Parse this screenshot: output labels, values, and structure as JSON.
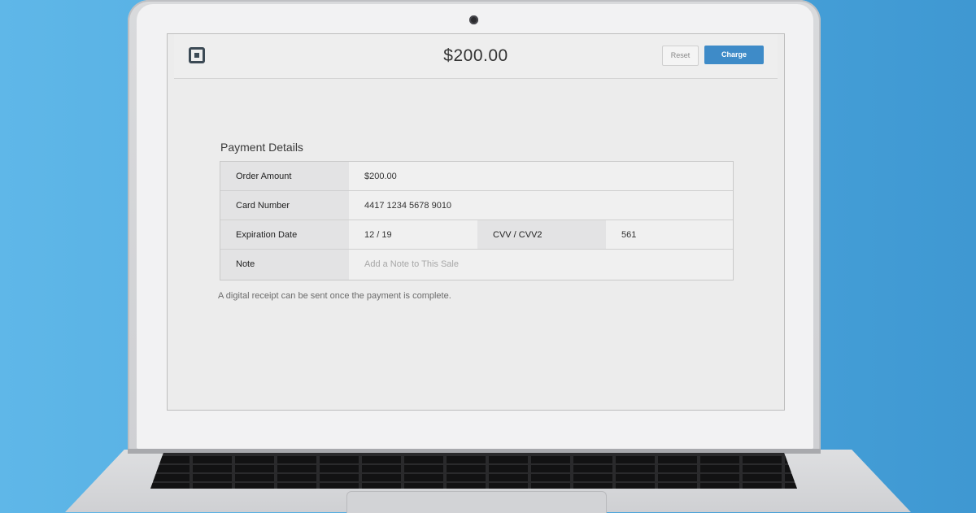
{
  "header": {
    "total": "$200.00",
    "reset_label": "Reset",
    "charge_label": "Charge"
  },
  "form": {
    "title": "Payment Details",
    "order_amount": {
      "label": "Order Amount",
      "value": "$200.00"
    },
    "card_number": {
      "label": "Card Number",
      "value": "4417 1234 5678 9010"
    },
    "expiration": {
      "label": "Expiration Date",
      "value": "12 / 19"
    },
    "cvv": {
      "label": "CVV / CVV2",
      "value": "561"
    },
    "note": {
      "label": "Note",
      "placeholder": "Add a Note to This Sale"
    }
  },
  "receipt_note": "A digital receipt can be sent once the payment is complete.",
  "colors": {
    "accent": "#3e8bc8",
    "background": "#4aa5dc"
  },
  "icons": {
    "logo": "square-logo-icon"
  }
}
